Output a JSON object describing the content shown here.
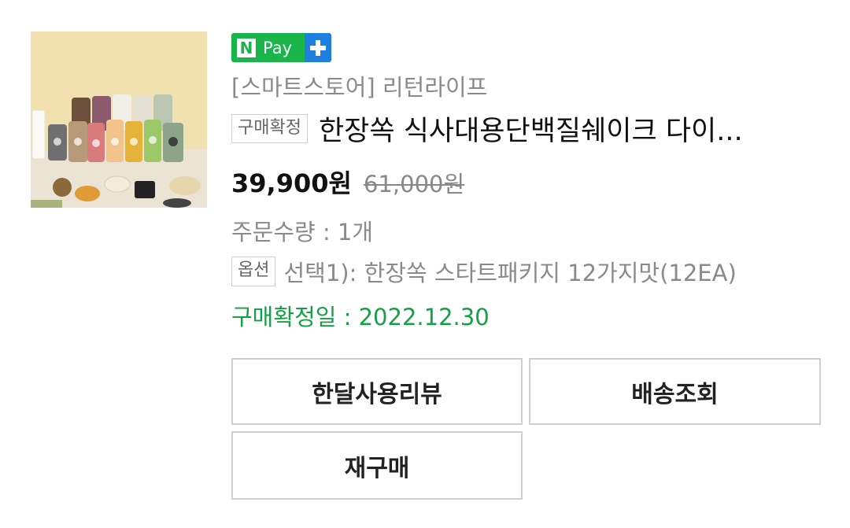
{
  "product": {
    "image_alt": "product-image",
    "npay_badge": {
      "n_letter": "N",
      "pay_label": "Pay",
      "plus_icon": "plus-icon",
      "colors": {
        "green": "#19b54a",
        "blue": "#1f7fe0"
      }
    },
    "store_name": "[스마트스토어] 리턴라이프",
    "status_tag": "구매확정",
    "title": "한장쏙 식사대용단백질쉐이크 다이...",
    "price": "39,900원",
    "original_price": "61,000원",
    "quantity": "주문수량 : 1개",
    "option_tag": "옵션",
    "option_text": "선택1): 한장쏙 스타트패키지 12가지맛(12EA)",
    "confirm_date": "구매확정일 : 2022.12.30",
    "confirm_color": "#15a046"
  },
  "actions": {
    "review_label": "한달사용리뷰",
    "shipping_label": "배송조회",
    "rebuy_label": "재구매"
  }
}
